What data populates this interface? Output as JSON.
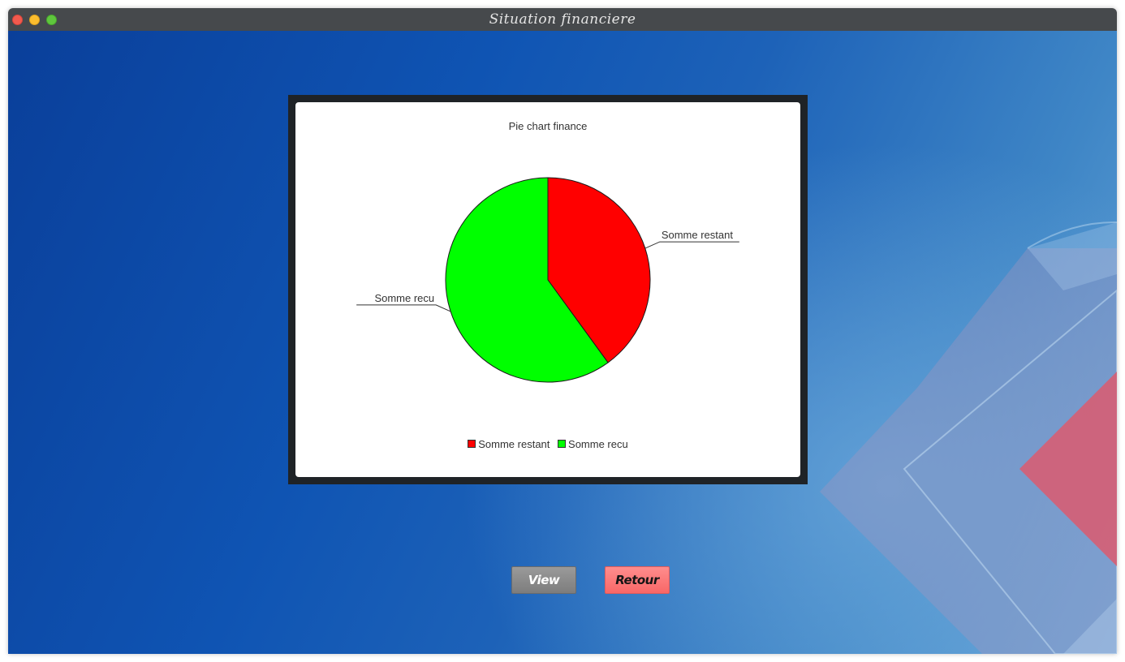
{
  "window": {
    "title": "Situation financiere"
  },
  "chart": {
    "title": "Pie chart finance"
  },
  "chart_data": {
    "type": "pie",
    "title": "Pie chart finance",
    "labels": [
      "Somme restant",
      "Somme recu"
    ],
    "values": [
      40,
      60
    ],
    "colors": [
      "#ff0000",
      "#00ff00"
    ],
    "legend_position": "bottom"
  },
  "legend": {
    "items": [
      {
        "label": "Somme restant",
        "color": "#ff0000"
      },
      {
        "label": "Somme recu",
        "color": "#00ff00"
      }
    ]
  },
  "buttons": {
    "view_label": "View",
    "retour_label": "Retour"
  }
}
